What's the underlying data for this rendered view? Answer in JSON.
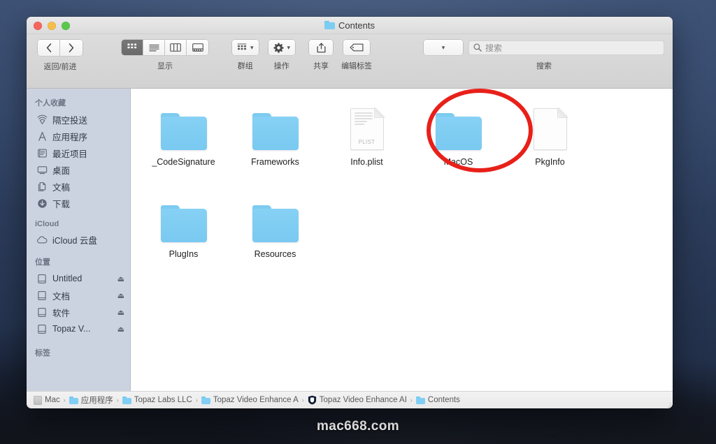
{
  "desktop": {
    "watermark": "mac668.com"
  },
  "window": {
    "title": "Contents",
    "title_icon": "folder-icon",
    "traffic_lights": [
      {
        "name": "close",
        "color": "#f5655b"
      },
      {
        "name": "minimize",
        "color": "#f7bd4c"
      },
      {
        "name": "maximize",
        "color": "#5bc84c"
      }
    ]
  },
  "toolbar": {
    "nav": {
      "back_icon": "chevron-left-icon",
      "forward_icon": "chevron-right-icon",
      "label": "返回/前进"
    },
    "view": {
      "label": "显示",
      "buttons": [
        {
          "name": "icon-view",
          "icon": "grid-icon",
          "active": true
        },
        {
          "name": "list-view",
          "icon": "list-icon",
          "active": false
        },
        {
          "name": "column-view",
          "icon": "columns-icon",
          "active": false
        },
        {
          "name": "gallery-view",
          "icon": "gallery-icon",
          "active": false
        }
      ]
    },
    "group": {
      "label": "群组",
      "icon": "group-grid-icon",
      "chevron": "chevron-down-icon"
    },
    "action": {
      "label": "操作",
      "icon": "gear-icon",
      "chevron": "chevron-down-icon"
    },
    "share": {
      "label": "共享",
      "icon": "share-icon"
    },
    "tags": {
      "label": "编辑标签",
      "icon": "tag-icon"
    },
    "search": {
      "label": "搜索",
      "placeholder": "搜索",
      "icon": "search-icon",
      "dropdown_chevron": "chevron-down-icon"
    }
  },
  "sidebar": {
    "sections": [
      {
        "header": "个人收藏",
        "items": [
          {
            "label": "隔空投送",
            "icon": "airdrop-icon",
            "eject": false
          },
          {
            "label": "应用程序",
            "icon": "applications-icon",
            "eject": false
          },
          {
            "label": "最近项目",
            "icon": "recents-icon",
            "eject": false
          },
          {
            "label": "桌面",
            "icon": "desktop-icon",
            "eject": false
          },
          {
            "label": "文稿",
            "icon": "documents-icon",
            "eject": false
          },
          {
            "label": "下载",
            "icon": "downloads-icon",
            "eject": false
          }
        ]
      },
      {
        "header": "iCloud",
        "items": [
          {
            "label": "iCloud 云盘",
            "icon": "cloud-icon",
            "eject": false
          }
        ]
      },
      {
        "header": "位置",
        "items": [
          {
            "label": "Untitled",
            "icon": "drive-icon",
            "eject": true
          },
          {
            "label": "文档",
            "icon": "drive-icon",
            "eject": true
          },
          {
            "label": "软件",
            "icon": "drive-icon",
            "eject": true
          },
          {
            "label": "Topaz V...",
            "icon": "drive-icon",
            "eject": true
          }
        ]
      },
      {
        "header": "标签",
        "items": []
      }
    ],
    "eject_icon": "eject-icon"
  },
  "files": [
    {
      "name": "_CodeSignature",
      "kind": "folder",
      "highlighted": false
    },
    {
      "name": "Frameworks",
      "kind": "folder",
      "highlighted": false
    },
    {
      "name": "Info.plist",
      "kind": "plist",
      "badge": "PLIST",
      "highlighted": false
    },
    {
      "name": "MacOS",
      "kind": "folder",
      "highlighted": true
    },
    {
      "name": "PkgInfo",
      "kind": "doc",
      "badge": "",
      "highlighted": false
    },
    {
      "name": "PlugIns",
      "kind": "folder",
      "highlighted": false
    },
    {
      "name": "Resources",
      "kind": "folder",
      "highlighted": false
    }
  ],
  "annotation": {
    "shape": "circle",
    "color": "#e8201a",
    "targets": "MacOS"
  },
  "pathbar": {
    "crumbs": [
      {
        "label": "Mac",
        "icon": "drive-icon"
      },
      {
        "label": "应用程序",
        "icon": "folder-icon"
      },
      {
        "label": "Topaz Labs LLC",
        "icon": "folder-icon"
      },
      {
        "label": "Topaz Video Enhance A",
        "icon": "folder-icon"
      },
      {
        "label": "Topaz Video Enhance AI",
        "icon": "app-shield-icon"
      },
      {
        "label": "Contents",
        "icon": "folder-icon"
      }
    ],
    "separator": "›"
  },
  "colors": {
    "folder_blue": "#80ceF3",
    "annotation_red": "#e8201a",
    "sidebar_bg": "#ccd3e0",
    "toolbar_bg": "#d8d8d8"
  }
}
